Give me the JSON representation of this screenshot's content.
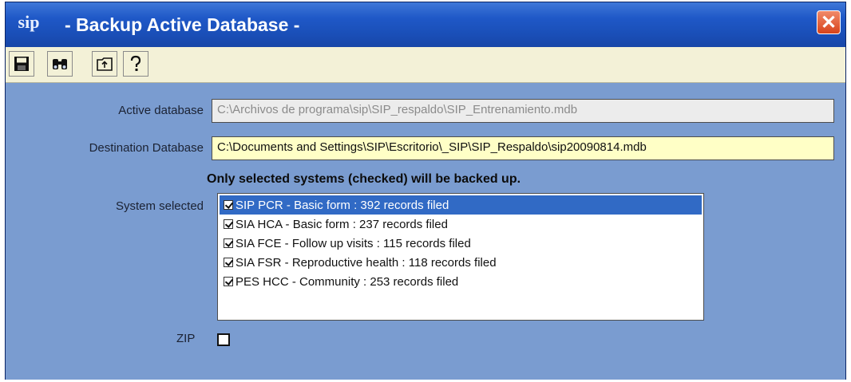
{
  "window": {
    "title": "- Backup Active Database -",
    "app_icon_text": "sip",
    "close_glyph": "✕"
  },
  "toolbar": {
    "buttons": [
      {
        "name": "save",
        "icon": "floppy-disk-icon"
      },
      {
        "name": "find",
        "icon": "binoculars-icon"
      },
      {
        "name": "up-folder",
        "icon": "up-folder-icon"
      },
      {
        "name": "help",
        "icon": "question-mark-icon"
      }
    ]
  },
  "form": {
    "active_database_label": "Active database",
    "active_database_value": "C:\\Archivos de programa\\sip\\SIP_respaldo\\SIP_Entrenamiento.mdb",
    "destination_database_label": "Destination Database",
    "destination_database_value": "C:\\Documents and Settings\\SIP\\Escritorio\\_SIP\\SIP_Respaldo\\sip20090814.mdb",
    "notice": "Only selected systems (checked) will be backed up.",
    "system_selected_label": "System selected",
    "systems": [
      {
        "label": "SIP PCR - Basic form : 392 records filed",
        "checked": true,
        "selected": true
      },
      {
        "label": "SIA HCA - Basic form : 237 records filed",
        "checked": true,
        "selected": false
      },
      {
        "label": "SIA FCE - Follow up visits : 115 records filed",
        "checked": true,
        "selected": false
      },
      {
        "label": "SIA FSR - Reproductive health : 118 records filed",
        "checked": true,
        "selected": false
      },
      {
        "label": "PES HCC - Community : 253 records filed",
        "checked": true,
        "selected": false
      }
    ],
    "zip_label": "ZIP",
    "zip_checked": false
  },
  "colors": {
    "titlebar": "#1f58c7",
    "body": "#7a9cd0",
    "toolbar": "#f3f1d7",
    "destination_field": "#ffffc6",
    "selected_row": "#316ac5"
  }
}
